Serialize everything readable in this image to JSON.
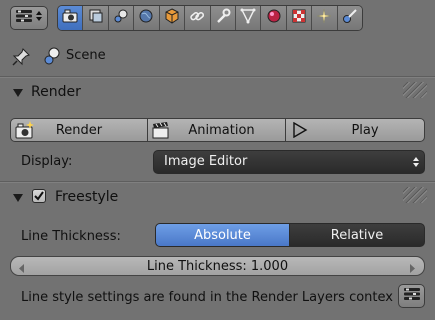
{
  "context": {
    "scene_label": "Scene"
  },
  "render_panel": {
    "title": "Render",
    "buttons": {
      "render": "Render",
      "animation": "Animation",
      "play": "Play"
    },
    "display_label": "Display:",
    "display_value": "Image Editor"
  },
  "freestyle_panel": {
    "title": "Freestyle",
    "enabled": true,
    "line_thickness_label": "Line Thickness:",
    "mode_absolute": "Absolute",
    "mode_relative": "Relative",
    "selected_mode": "Absolute",
    "slider_text": "Line Thickness: 1.000",
    "info_text": "Line style settings are found in the Render Layers contex"
  },
  "colors": {
    "background": "#727272",
    "active_tab": "#4a78c8",
    "selected_segment": "#5a8ad6",
    "dark_widget": "#333333"
  },
  "icons": {
    "editor_type": "properties-editor-icon",
    "tabs": [
      "render-tab-icon",
      "render-layers-tab-icon",
      "scene-tab-icon",
      "world-tab-icon",
      "object-tab-icon",
      "constraints-tab-icon",
      "modifiers-tab-icon",
      "data-tab-icon",
      "material-tab-icon",
      "texture-tab-icon",
      "particles-tab-icon",
      "physics-tab-icon"
    ]
  }
}
